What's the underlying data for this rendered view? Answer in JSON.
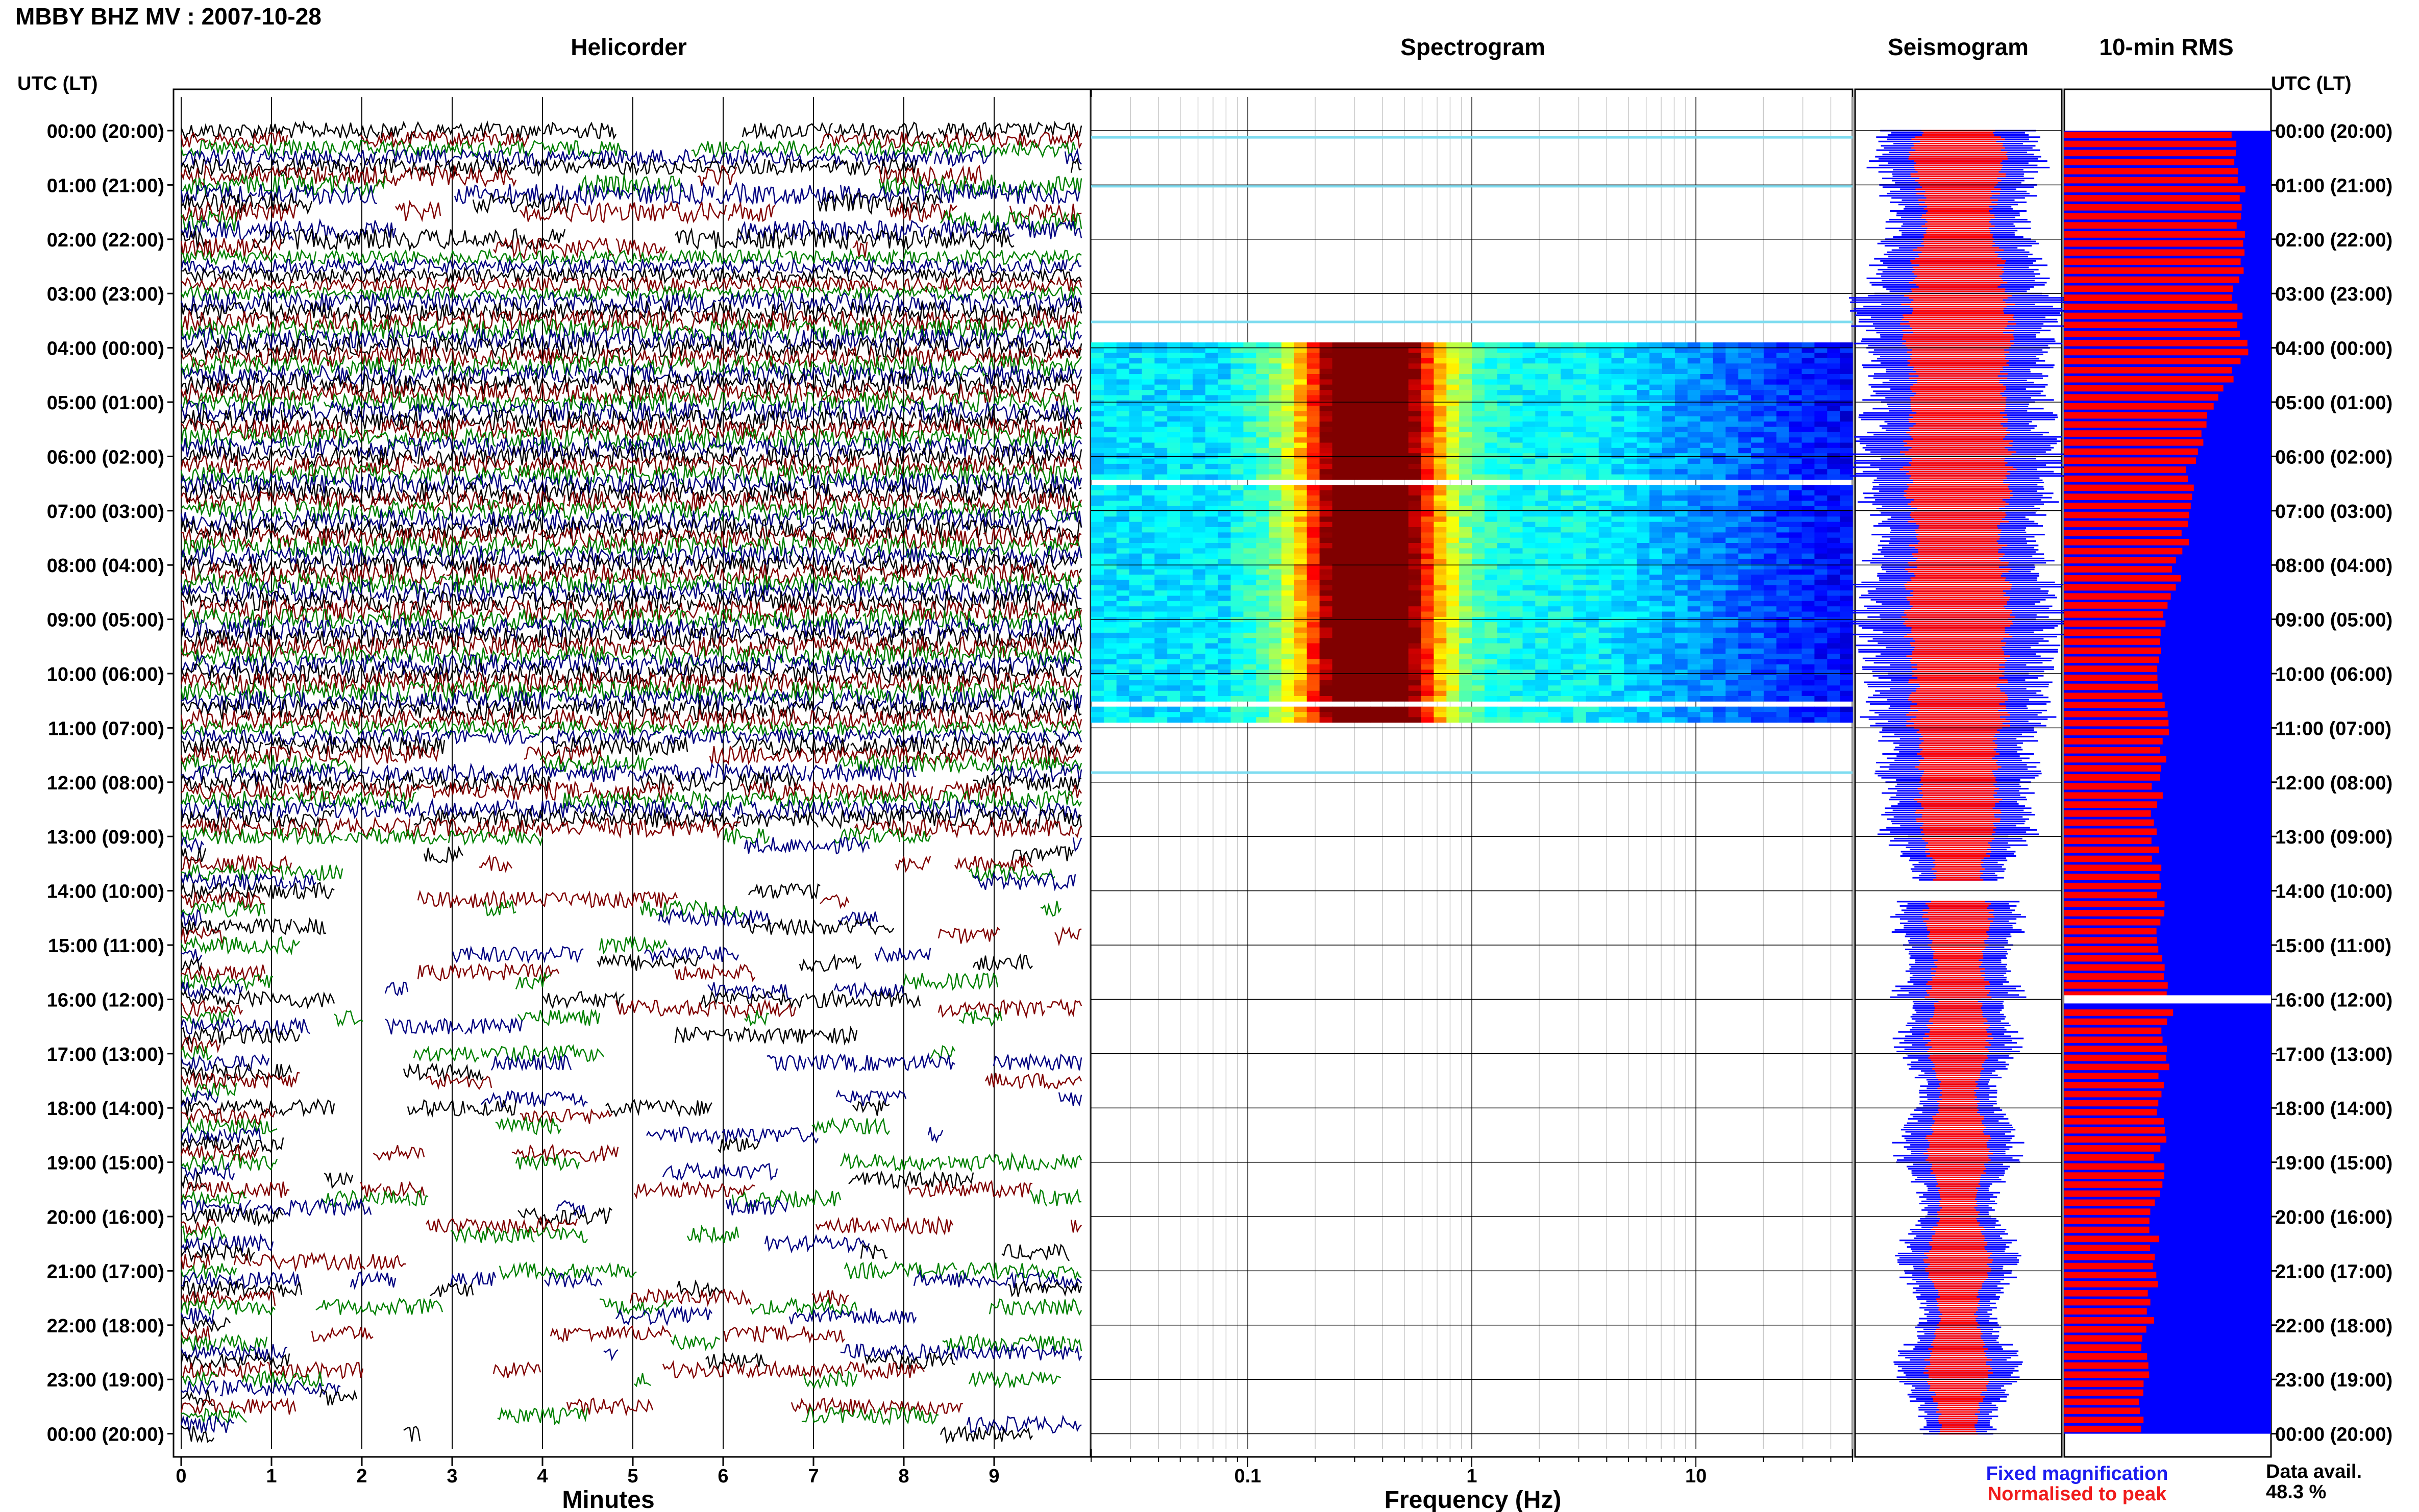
{
  "header": {
    "station_title": "MBBY BHZ MV : 2007-10-28",
    "time_axis_label": "UTC (LT)"
  },
  "panels": {
    "helicorder": "Helicorder",
    "spectrogram": "Spectrogram",
    "seismogram": "Seismogram",
    "rms": "10-min RMS"
  },
  "footer": {
    "minutes_label": "Minutes",
    "frequency_label": "Frequency (Hz)",
    "legend_fixed": "Fixed magnification",
    "legend_normalised": "Normalised to peak",
    "data_avail_label": "Data avail.",
    "data_avail_value": "48.3 %"
  },
  "colors": {
    "trace_black": "#000000",
    "trace_red": "#800000",
    "trace_green": "#008000",
    "trace_blue": "#000080",
    "fixed": "#0000ff",
    "normalised": "#ff0000"
  },
  "chart_data": [
    {
      "type": "line",
      "name": "helicorder",
      "title": "Helicorder",
      "xlabel": "Minutes",
      "x_ticks": [
        0,
        1,
        2,
        3,
        4,
        5,
        6,
        7,
        8,
        9
      ],
      "xlim": [
        0,
        10
      ],
      "row_labels": [
        "00:00 (20:00)",
        "01:00 (21:00)",
        "02:00 (22:00)",
        "03:00 (23:00)",
        "04:00 (00:00)",
        "05:00 (01:00)",
        "06:00 (02:00)",
        "07:00 (03:00)",
        "08:00 (04:00)",
        "09:00 (05:00)",
        "10:00 (06:00)",
        "11:00 (07:00)",
        "12:00 (08:00)",
        "13:00 (09:00)",
        "14:00 (10:00)",
        "15:00 (11:00)",
        "16:00 (12:00)",
        "17:00 (13:00)",
        "18:00 (14:00)",
        "19:00 (15:00)",
        "20:00 (16:00)",
        "21:00 (17:00)",
        "22:00 (18:00)",
        "23:00 (19:00)",
        "00:00 (20:00)"
      ],
      "trace_color_cycle": [
        "black",
        "red",
        "green",
        "blue"
      ],
      "rows_per_hour": 6
    },
    {
      "type": "heatmap",
      "name": "spectrogram",
      "title": "Spectrogram",
      "xlabel": "Frequency (Hz)",
      "x_scale": "log",
      "x_ticks": [
        0.1,
        1,
        10
      ],
      "xlim": [
        0.02,
        50
      ],
      "active_hours": [
        3.9,
        10.9
      ],
      "peak_band_hz": [
        0.25,
        0.5
      ],
      "sparse_rows_hours": [
        0.1,
        1.0,
        3.5,
        11.8
      ]
    },
    {
      "type": "area",
      "name": "seismogram",
      "title": "Seismogram",
      "series": [
        {
          "name": "Fixed magnification",
          "color": "#0000ff"
        },
        {
          "name": "Normalised to peak",
          "color": "#ff0000"
        }
      ],
      "gap_hours": [
        13.8,
        14.2
      ]
    },
    {
      "type": "bar",
      "name": "rms",
      "title": "10-min RMS",
      "orientation": "horizontal",
      "xlim": [
        0,
        1
      ],
      "hour_values": [
        0.8,
        0.85,
        0.87,
        0.83,
        0.88,
        0.72,
        0.62,
        0.6,
        0.55,
        0.48,
        0.45,
        0.48,
        0.45,
        0.44,
        0.46,
        0.45,
        0.5,
        0.48,
        0.47,
        0.46,
        0.44,
        0.43,
        0.4,
        0.38,
        0.36
      ],
      "gap_hour": 16.0,
      "series": [
        {
          "name": "Fixed magnification",
          "color": "#0000ff"
        },
        {
          "name": "Normalised to peak",
          "color": "#ff0000"
        }
      ]
    }
  ]
}
